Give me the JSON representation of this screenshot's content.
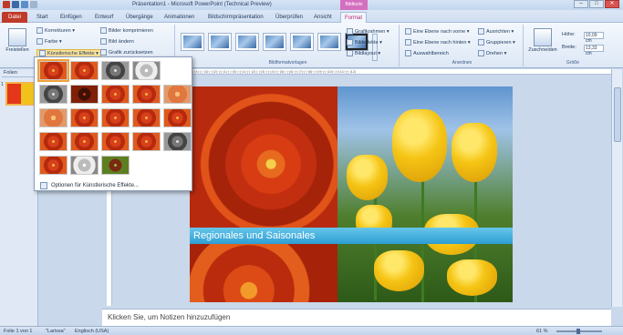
{
  "window": {
    "title": "Präsentation1 - Microsoft PowerPoint (Technical Preview)",
    "context_tab_header": "Bildtools",
    "minimize": "–",
    "maximize": "□",
    "close": "✕"
  },
  "tabs": [
    "Datei",
    "Start",
    "Einfügen",
    "Entwurf",
    "Übergänge",
    "Animationen",
    "Bildschirmpräsentation",
    "Überprüfen",
    "Ansicht",
    "Format"
  ],
  "ribbon": {
    "remove_bg": "Freistellen",
    "corrections": "Korrekturen ▾",
    "color": "Farbe ▾",
    "artistic_effects": "Künstlerische Effekte ▾",
    "compress": "Bilder komprimieren",
    "change_picture": "Bild ändern",
    "reset_picture": "Grafik zurücksetzen",
    "picture_styles_label": "Bildformatvorlagen",
    "picture_border": "Grafikrahmen ▾",
    "picture_effects": "Bildeffekte ▾",
    "picture_layout": "Bildlayout ▾",
    "bring_forward": "Eine Ebene nach vorne ▾",
    "send_backward": "Eine Ebene nach hinten ▾",
    "selection_pane": "Auswahlbereich",
    "align": "Ausrichten ▾",
    "group": "Gruppieren ▾",
    "rotate": "Drehen ▾",
    "arrange_label": "Anordnen",
    "crop": "Zuschneiden",
    "height_label": "Höhe:",
    "height_value": "10,09 cm",
    "width_label": "Breite:",
    "width_value": "13,33 cm",
    "size_label": "Größe"
  },
  "slides_pane": {
    "tab_label": "Folien",
    "slide_number": "1"
  },
  "slide": {
    "banner_text": "Regionales und Saisonales"
  },
  "notes": {
    "placeholder": "Klicken Sie, um Notizen hinzuzufügen"
  },
  "dropdown": {
    "option_label": "Optionen für Künstlerische Effekte..."
  },
  "ruler_text": "|12|·|·|·|11|·|·|·|10|·|·|·|9|·|·|·|8|·|·|·|7|·|·|·|6|·|·|·|5|·|·|·|4|·|·|·|3|·|·|·|2|·|·|·|1|·|·|·|0|·|·|·|1|·|·|·|2|·|·|·|3|·|·|·|4|·|·|·|5|·|·|·|6|·|·|·|7|·|·|·|8|·|·|·|9|·|·|·|10|·|·|·|11|·|·|·|12|",
  "status": {
    "slide_info": "Folie 1 von 1",
    "theme": "\"Larissa\"",
    "language": "Englisch (USA)",
    "zoom": "61 %"
  },
  "colors": {
    "file_tab": "#c03a29",
    "context_tab": "#d46fbf",
    "banner": "#2d9ed3",
    "highlight": "#fbe19a"
  }
}
